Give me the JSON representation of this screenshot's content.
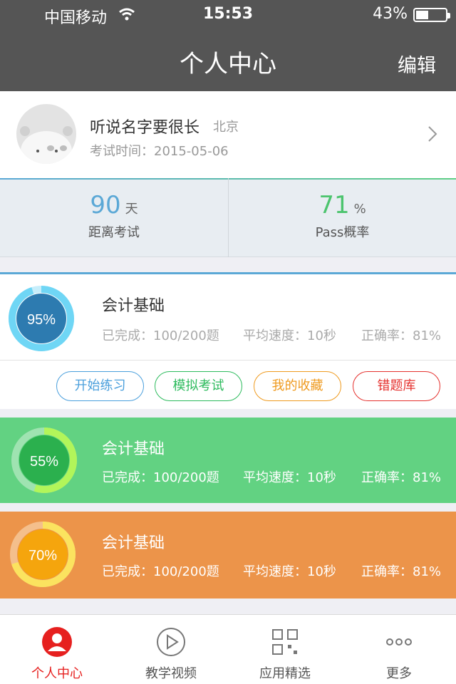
{
  "status_bar": {
    "carrier": "中国移动",
    "time": "15:53",
    "battery": "43%",
    "battery_level": 0.43
  },
  "nav": {
    "title": "个人中心",
    "edit_label": "编辑"
  },
  "profile": {
    "name": "听说名字要很长",
    "city": "北京",
    "exam_time": "考试时间：2015-05-06"
  },
  "stats": {
    "days": {
      "value": "90",
      "unit": "天",
      "label": "距离考试"
    },
    "pass": {
      "value": "71",
      "unit": "%",
      "label": "Pass概率"
    }
  },
  "courses": [
    {
      "title": "会计基础",
      "percent": "95%",
      "progress": 0.95,
      "completed": "已完成：100/200题",
      "speed": "平均速度：10秒",
      "accuracy": "正确率：81%"
    },
    {
      "title": "会计基础",
      "percent": "55%",
      "progress": 0.55,
      "completed": "已完成：100/200题",
      "speed": "平均速度：10秒",
      "accuracy": "正确率：81%"
    },
    {
      "title": "会计基础",
      "percent": "70%",
      "progress": 0.7,
      "completed": "已完成：100/200题",
      "speed": "平均速度：10秒",
      "accuracy": "正确率：81%"
    }
  ],
  "actions": [
    {
      "label": "开始练习",
      "color": "#4a9fdc"
    },
    {
      "label": "模拟考试",
      "color": "#2dbb5d"
    },
    {
      "label": "我的收藏",
      "color": "#ef9a1e"
    },
    {
      "label": "错题库",
      "color": "#e5312e"
    }
  ],
  "tabs": [
    {
      "label": "个人中心",
      "icon": "user-icon",
      "active": true
    },
    {
      "label": "教学视频",
      "icon": "play-icon",
      "active": false
    },
    {
      "label": "应用精选",
      "icon": "apps-grid-icon",
      "active": false
    },
    {
      "label": "更多",
      "icon": "more-dots-icon",
      "active": false
    }
  ],
  "colors": {
    "header": "#555555",
    "accent_red": "#e6201f",
    "green_card": "#62d282",
    "orange_card": "#ec944a",
    "blue_number": "#5ba8d6",
    "green_number": "#4cc46e"
  }
}
